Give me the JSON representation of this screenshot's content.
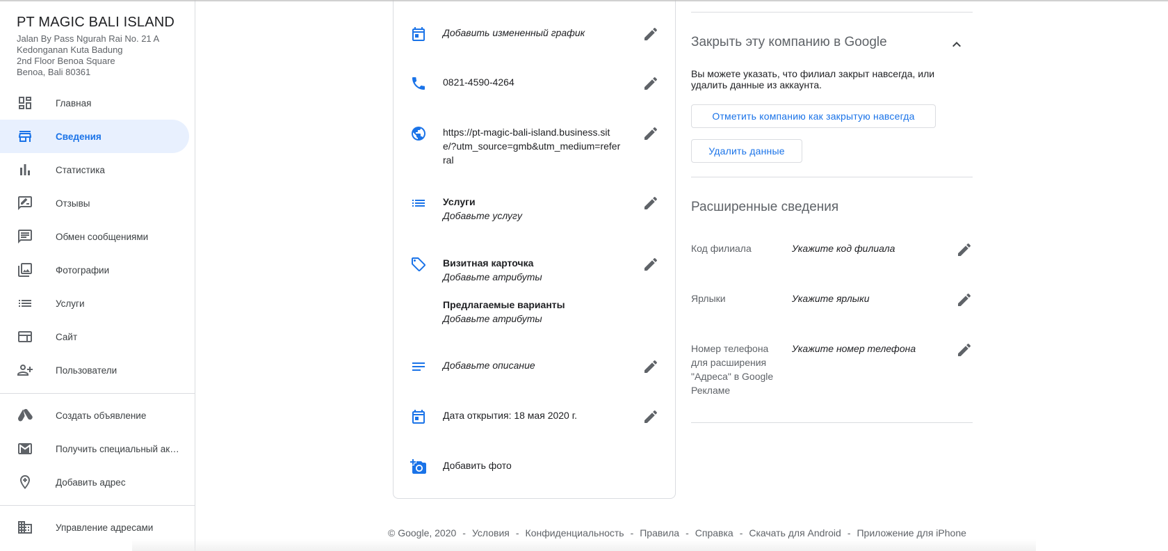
{
  "business": {
    "name": "PT MAGIC BALI ISLAND",
    "address_lines": [
      "Jalan By Pass Ngurah Rai No. 21 A",
      "Kedonganan Kuta Badung",
      "2nd Floor Benoa Square",
      "Benoa, Bali 80361"
    ]
  },
  "sidebar": {
    "items": [
      {
        "label": "Главная",
        "icon": "dashboard-icon"
      },
      {
        "label": "Сведения",
        "icon": "store-icon",
        "active": true
      },
      {
        "label": "Статистика",
        "icon": "bar-chart-icon"
      },
      {
        "label": "Отзывы",
        "icon": "rate-review-icon"
      },
      {
        "label": "Обмен сообщениями",
        "icon": "message-icon"
      },
      {
        "label": "Фотографии",
        "icon": "photo-library-icon"
      },
      {
        "label": "Услуги",
        "icon": "list-icon"
      },
      {
        "label": "Сайт",
        "icon": "web-icon"
      },
      {
        "label": "Пользователи",
        "icon": "person-add-icon"
      }
    ],
    "secondary": [
      {
        "label": "Создать объявление",
        "icon": "google-ads-icon"
      },
      {
        "label": "Получить специальный акк...",
        "icon": "gmail-icon"
      },
      {
        "label": "Добавить адрес",
        "icon": "add-location-icon"
      }
    ],
    "manage": {
      "label": "Управление адресами",
      "icon": "domain-icon"
    }
  },
  "info": {
    "schedule": "Добавить измененный график",
    "phone": "0821-4590-4264",
    "website": "https://pt-magic-bali-island.business.site/?utm_source=gmb&utm_medium=referral",
    "website_lines": [
      "https://pt-magic-bali-island.business.sit",
      "e/?utm_source=gmb&utm_medium=refer",
      "ral"
    ],
    "services_title": "Услуги",
    "services_value": "Добавьте услугу",
    "attributes_title": "Визитная карточка",
    "attributes_value": "Добавьте атрибуты",
    "suggested_title": "Предлагаемые варианты",
    "suggested_value": "Добавьте атрибуты",
    "description": "Добавьте описание",
    "opening_date": "Дата открытия: 18 мая 2020 г.",
    "add_photo": "Добавить фото"
  },
  "close_section": {
    "title": "Закрыть эту компанию в Google",
    "description": "Вы можете указать, что филиал закрыт навсегда, или удалить данные из аккаунта.",
    "mark_closed_button": "Отметить компанию как закрытую навсегда",
    "delete_button": "Удалить данные"
  },
  "advanced": {
    "title": "Расширенные сведения",
    "rows": [
      {
        "label": "Код филиала",
        "value": "Укажите код филиала"
      },
      {
        "label": "Ярлыки",
        "value": "Укажите ярлыки"
      },
      {
        "label": "Номер телефона для расширения \"Адреса\" в Google Рекламе",
        "value": "Укажите номер телефона"
      }
    ]
  },
  "footer": {
    "copyright": "© Google, 2020",
    "links": [
      "Условия",
      "Конфиденциальность",
      "Правила",
      "Справка",
      "Скачать для Android",
      "Приложение для iPhone"
    ]
  },
  "colors": {
    "accent": "#1a73e8",
    "active_bg": "#e8f0fe",
    "text": "#202124",
    "muted": "#5f6368",
    "divider": "#dadce0"
  }
}
